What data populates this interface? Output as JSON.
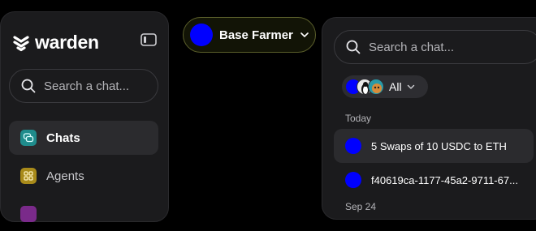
{
  "brand": {
    "name": "warden"
  },
  "sidebar": {
    "search_placeholder": "Search a chat...",
    "nav": [
      {
        "label": "Chats",
        "icon": "chat-bubbles-icon",
        "color": "#1f8c8c",
        "active": true
      },
      {
        "label": "Agents",
        "icon": "grid-icon",
        "color": "#a88a1a",
        "active": false
      }
    ]
  },
  "agent_selector": {
    "name": "Base Farmer",
    "avatar_color": "#0000ff"
  },
  "panel": {
    "search_placeholder": "Search a chat...",
    "filter": {
      "label": "All"
    },
    "sections": [
      {
        "label": "Today",
        "items": [
          {
            "title": "5 Swaps of 10 USDC to ETH",
            "avatar_color": "#0000ff",
            "active": true
          },
          {
            "title": "f40619ca-1177-45a2-9711-67...",
            "avatar_color": "#0000ff",
            "active": false
          }
        ]
      },
      {
        "label": "Sep 24",
        "items": []
      }
    ]
  }
}
